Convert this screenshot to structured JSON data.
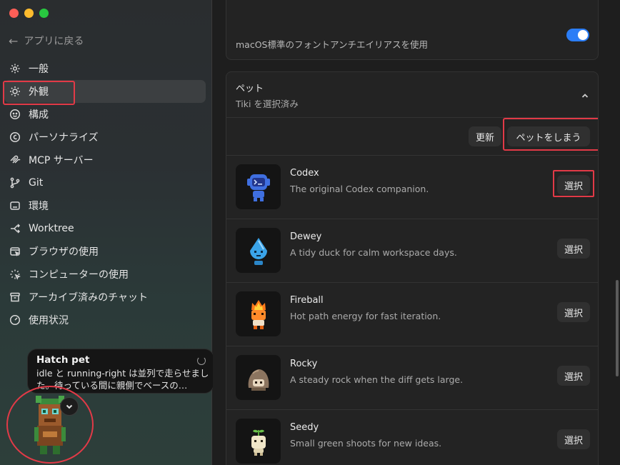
{
  "sidebar": {
    "back_label": "アプリに戻る",
    "items": [
      {
        "label": "一般",
        "icon": "gear-icon"
      },
      {
        "label": "外観",
        "icon": "sun-icon"
      },
      {
        "label": "構成",
        "icon": "face-icon"
      },
      {
        "label": "パーソナライズ",
        "icon": "personalize-icon"
      },
      {
        "label": "MCP サーバー",
        "icon": "mcp-icon"
      },
      {
        "label": "Git",
        "icon": "git-branch-icon"
      },
      {
        "label": "環境",
        "icon": "environment-icon"
      },
      {
        "label": "Worktree",
        "icon": "worktree-icon"
      },
      {
        "label": "ブラウザの使用",
        "icon": "browser-icon"
      },
      {
        "label": "コンピューターの使用",
        "icon": "computer-use-icon"
      },
      {
        "label": "アーカイブ済みのチャット",
        "icon": "archive-icon"
      },
      {
        "label": "使用状況",
        "icon": "usage-gauge-icon"
      }
    ],
    "active_index": 1
  },
  "hatch": {
    "title": "Hatch pet",
    "text": "idle と running-right は並列で走らせました。待っている間に親側でベースの…"
  },
  "main": {
    "font_setting_desc": "macOS標準のフォントアンチエイリアスを使用",
    "font_toggle_on": true,
    "pet_section": {
      "title": "ペット",
      "subtitle": "Tiki を選択済み",
      "refresh_label": "更新",
      "hide_label": "ペットをしまう",
      "select_label": "選択",
      "pets": [
        {
          "name": "Codex",
          "desc": "The original Codex companion."
        },
        {
          "name": "Dewey",
          "desc": "A tidy duck for calm workspace days."
        },
        {
          "name": "Fireball",
          "desc": "Hot path energy for fast iteration."
        },
        {
          "name": "Rocky",
          "desc": "A steady rock when the diff gets large."
        },
        {
          "name": "Seedy",
          "desc": "Small green shoots for new ideas."
        }
      ]
    }
  },
  "colors": {
    "accent": "#2b7df6",
    "highlight_box": "#e23a47"
  }
}
